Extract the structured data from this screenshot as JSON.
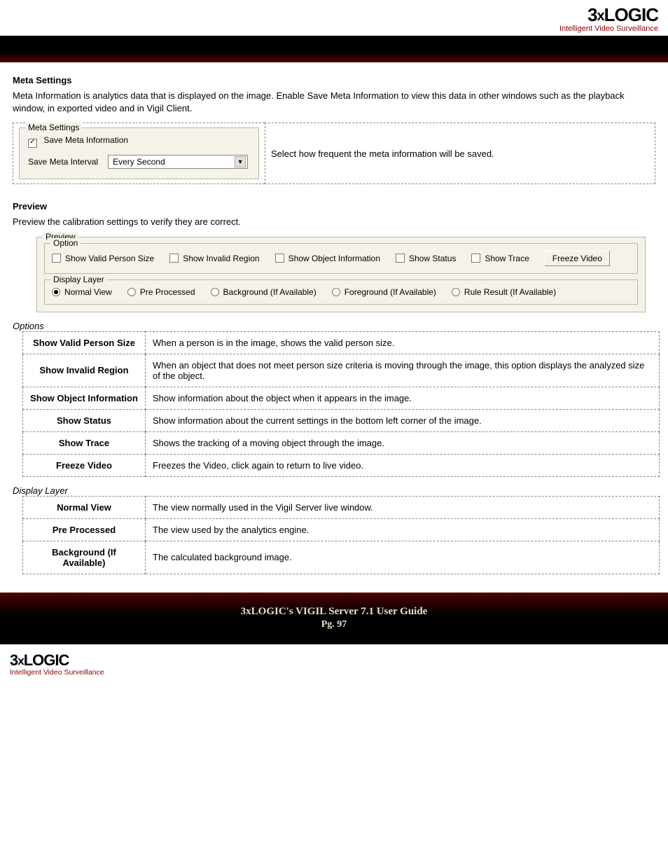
{
  "brand": {
    "name": "3xLOGIC",
    "tagline": "Intelligent Video Surveillance"
  },
  "meta": {
    "heading": "Meta Settings",
    "intro": "Meta Information is analytics data that is displayed on the image. Enable Save Meta Information to view this data in other windows such as the playback window, in exported video and in Vigil Client.",
    "fs_legend": "Meta Settings",
    "cb_label": "Save Meta Information",
    "interval_label": "Save Meta Interval",
    "interval_value": "Every Second",
    "desc": "Select how frequent the meta information will be saved."
  },
  "preview": {
    "heading": "Preview",
    "intro": "Preview the calibration settings to verify they are correct.",
    "outer_legend": "Preview",
    "option_legend": "Option",
    "display_legend": "Display Layer",
    "opts": {
      "valid": "Show Valid Person Size",
      "invalid": "Show Invalid Region",
      "objinfo": "Show Object Information",
      "status": "Show Status",
      "trace": "Show Trace",
      "freeze": "Freeze Video"
    },
    "layers": {
      "normal": "Normal View",
      "pre": "Pre Processed",
      "bg": "Background (If Available)",
      "fg": "Foreground (If Available)",
      "rule": "Rule Result (If Available)"
    }
  },
  "opt_table_heading": "Options",
  "opt_table": [
    {
      "k": "Show Valid Person Size",
      "v": "When a person is in the image, shows the valid person size."
    },
    {
      "k": "Show Invalid Region",
      "v": "When an object that does not meet person size criteria is moving through the image, this option displays the analyzed size of the object."
    },
    {
      "k": "Show Object Information",
      "v": "Show information about the object when it appears in the image."
    },
    {
      "k": "Show Status",
      "v": "Show information about the current settings in the bottom left corner of the image."
    },
    {
      "k": "Show Trace",
      "v": "Shows the tracking of a moving object through the image."
    },
    {
      "k": "Freeze Video",
      "v": "Freezes the Video, click again to return to live video."
    }
  ],
  "dl_table_heading": "Display Layer",
  "dl_table": [
    {
      "k": "Normal View",
      "v": "The view normally used in the Vigil Server live window."
    },
    {
      "k": "Pre Processed",
      "v": "The view used by the analytics engine."
    },
    {
      "k": "Background (If Available)",
      "v": "The calculated background image."
    }
  ],
  "footer": {
    "title": "3xLOGIC's VIGIL Server 7.1 User Guide",
    "page": "Pg. 97"
  }
}
